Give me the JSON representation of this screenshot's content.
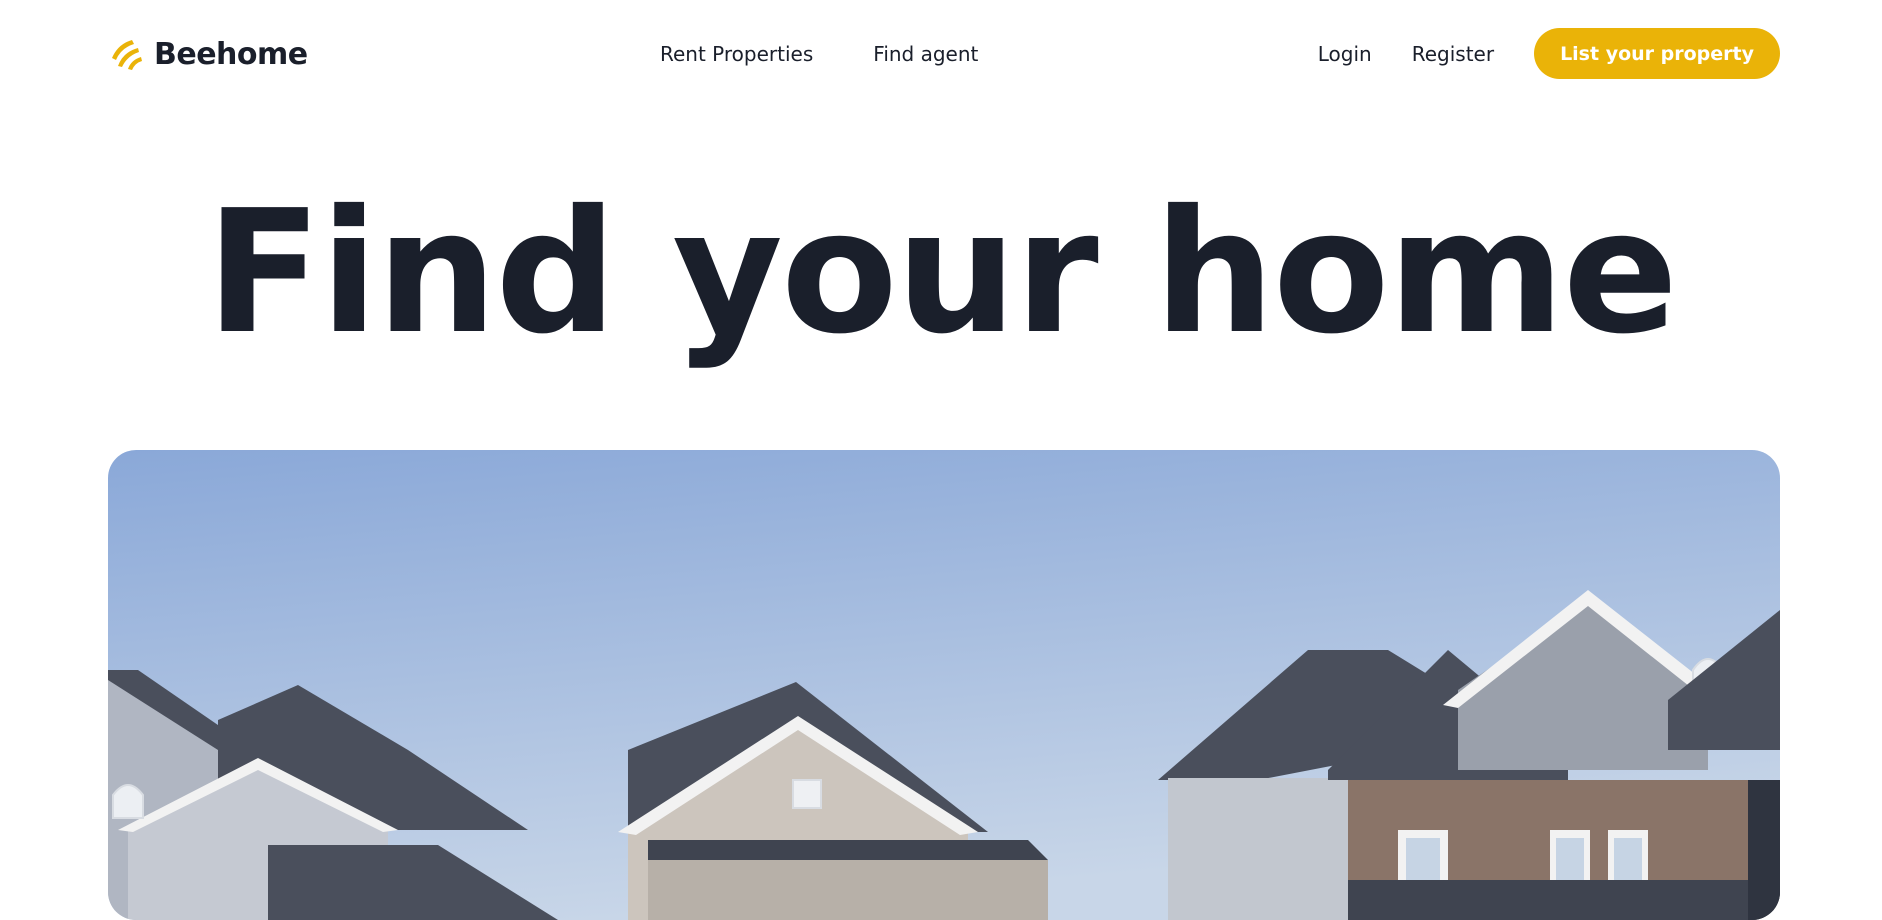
{
  "brand": {
    "name": "Beehome",
    "logo_icon": "bee-stripes-icon",
    "accent_color": "#eab308"
  },
  "nav": {
    "center_links": [
      "Rent Properties",
      "Find agent"
    ],
    "login_label": "Login",
    "register_label": "Register",
    "cta_label": "List your property"
  },
  "hero": {
    "title": "Find your home",
    "image": "suburban-houses-rooftops-photo"
  },
  "colors": {
    "text_dark": "#1a1f2b",
    "sky_top": "#8aa8d8",
    "sky_bottom": "#c8d6e8",
    "roof": "#4a4f5c",
    "siding": "#b0b6c2",
    "brick": "#8a7468",
    "white_trim": "#f2f2f2"
  }
}
